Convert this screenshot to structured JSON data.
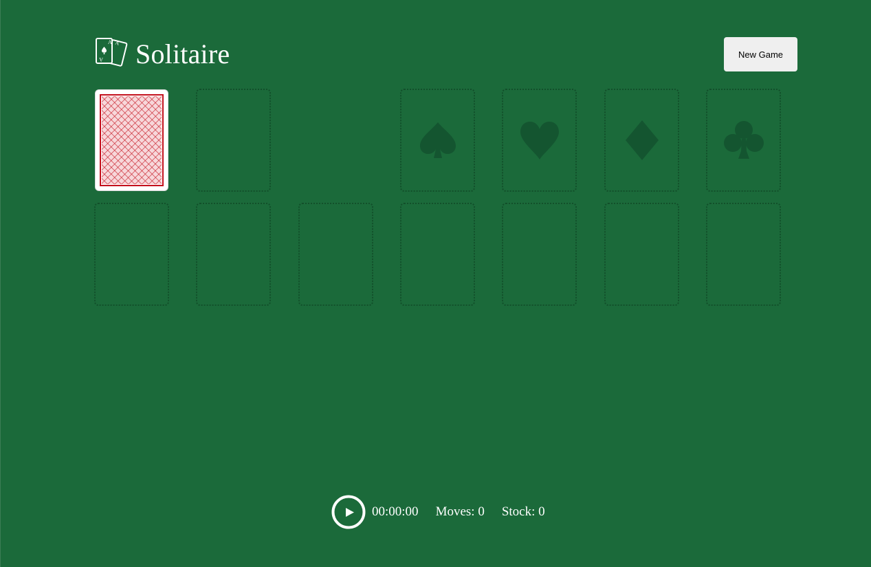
{
  "app": {
    "title": "Solitaire",
    "logo_icon": "playing-cards-icon"
  },
  "toolbar": {
    "new_game_label": "New Game"
  },
  "stock": {
    "card_back_color": "#c4101c",
    "has_cards": true
  },
  "foundations": [
    {
      "suit": "spades",
      "icon": "spade-icon"
    },
    {
      "suit": "hearts",
      "icon": "heart-icon"
    },
    {
      "suit": "diamonds",
      "icon": "diamond-icon"
    },
    {
      "suit": "clubs",
      "icon": "club-icon"
    }
  ],
  "tableau": {
    "columns": 7
  },
  "status": {
    "play_icon": "play-icon",
    "timer": "00:00:00",
    "moves": "Moves: 0",
    "stock": "Stock: 0"
  },
  "colors": {
    "table": "#1b6a3a",
    "slot_border": "#124f2a",
    "suit_fill": "#145530"
  }
}
